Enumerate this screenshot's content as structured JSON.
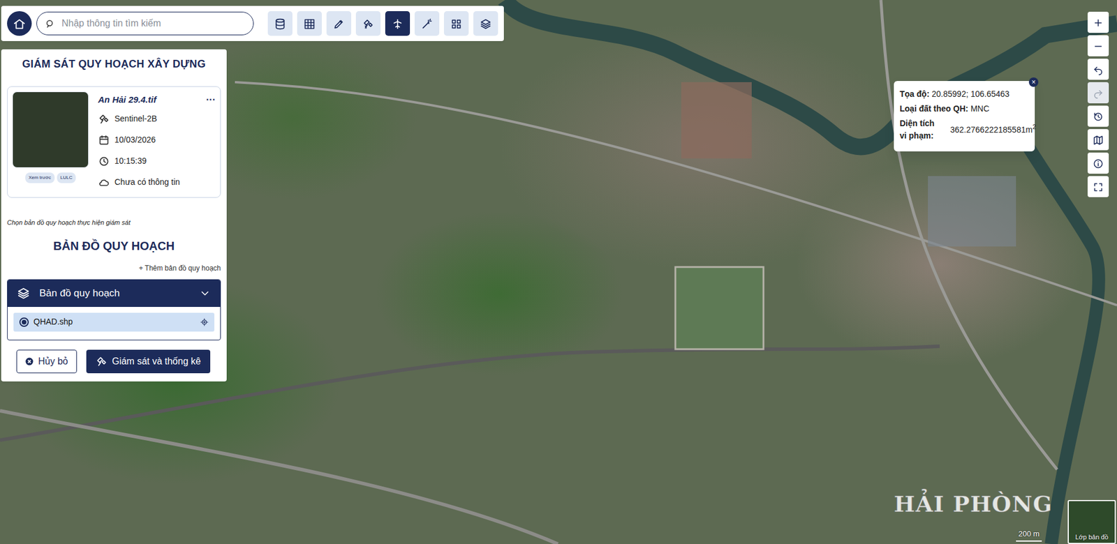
{
  "search": {
    "placeholder": "Nhập thông tin tìm kiếm"
  },
  "toolbar": [
    {
      "selected": false
    },
    {
      "selected": false
    },
    {
      "selected": false
    },
    {
      "selected": false
    },
    {
      "selected": true
    },
    {
      "selected": false
    },
    {
      "selected": false
    },
    {
      "selected": false
    }
  ],
  "panel": {
    "title": "GIÁM SÁT QUY HOẠCH XÂY DỰNG",
    "image": {
      "name": "An Hải 29.4.tif",
      "more": "···",
      "satellite": "Sentinel-2B",
      "date": "10/03/2026",
      "time": "10:15:39",
      "cloud": "Chưa có thông tin",
      "badges": [
        "Xem trước",
        "LULC"
      ]
    },
    "hint": "Chọn bản đồ quy hoạch thực hiện giám sát",
    "map_title": "BẢN ĐỒ QUY HOẠCH",
    "add_label": "+ Thêm bản đồ quy hoạch",
    "group": {
      "title": "Bản đồ quy hoạch",
      "expanded": true
    },
    "layers": [
      {
        "name": "QHAD.shp",
        "selected": true
      }
    ],
    "buttons": {
      "cancel": "Hủy bỏ",
      "submit": "Giám sát và thống kê"
    }
  },
  "map_controls": [
    {
      "disabled": false
    },
    {
      "disabled": false
    },
    {
      "disabled": false
    },
    {
      "disabled": true
    },
    {
      "disabled": false
    },
    {
      "disabled": false
    },
    {
      "disabled": false
    },
    {
      "disabled": false
    }
  ],
  "popup": {
    "close": "×",
    "rows": [
      {
        "kind": "inline",
        "label": "Tọa độ:",
        "value": "20.85992; 106.65463",
        "sup": ""
      },
      {
        "kind": "inline",
        "label": "Loại đất theo QH:",
        "value": "MNC",
        "sup": ""
      },
      {
        "kind": "stacked",
        "label": "Diện tích vi phạm:",
        "value": "362.2766222185581m",
        "sup": "2"
      }
    ]
  },
  "watermark": "HẢI PHÒNG",
  "scale": "200 m",
  "basemap": {
    "label": "Lớp bản đồ"
  }
}
